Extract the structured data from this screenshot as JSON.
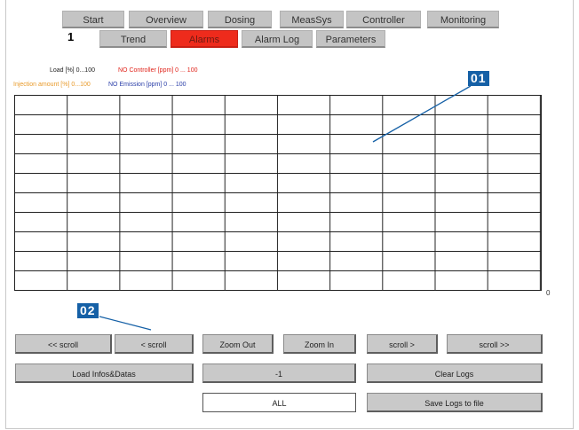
{
  "nav": {
    "tabs": [
      "Start",
      "Overview",
      "Dosing",
      "MeasSys",
      "Controller",
      "Monitoring"
    ]
  },
  "subnav": {
    "screen_number": "1",
    "tabs": [
      "Trend",
      "Alarms",
      "Alarm Log",
      "Parameters"
    ],
    "active": "Alarms"
  },
  "legend": {
    "load": "Load [%] 0...100",
    "no_controller": "NO Controller [ppm] 0 ... 100",
    "injection": "Injection amount [%] 0...100",
    "no_emission": "NO Emission [ppm] 0 ... 100"
  },
  "chart_data": {
    "type": "line",
    "series": [],
    "y_min_label": "0",
    "grid": true,
    "columns": 10,
    "rows": 10
  },
  "callouts": [
    "01",
    "02"
  ],
  "controls": {
    "scroll_first": "<< scroll",
    "scroll_back": "< scroll",
    "zoom_out": "Zoom Out",
    "zoom_in": "Zoom In",
    "scroll_fwd": "scroll >",
    "scroll_last": "scroll >>",
    "load_infos": "Load Infos&Datas",
    "page_value": "-1",
    "clear_logs": "Clear Logs",
    "filter_value": "ALL",
    "save_logs": "Save Logs to file"
  },
  "colors": {
    "active_tab": "#ee2b1c",
    "callout_badge": "#1560a6",
    "legend_load": "#222222",
    "legend_no_controller": "#e0231a",
    "legend_injection": "#e89a2a",
    "legend_no_emission": "#2a3ea8"
  }
}
